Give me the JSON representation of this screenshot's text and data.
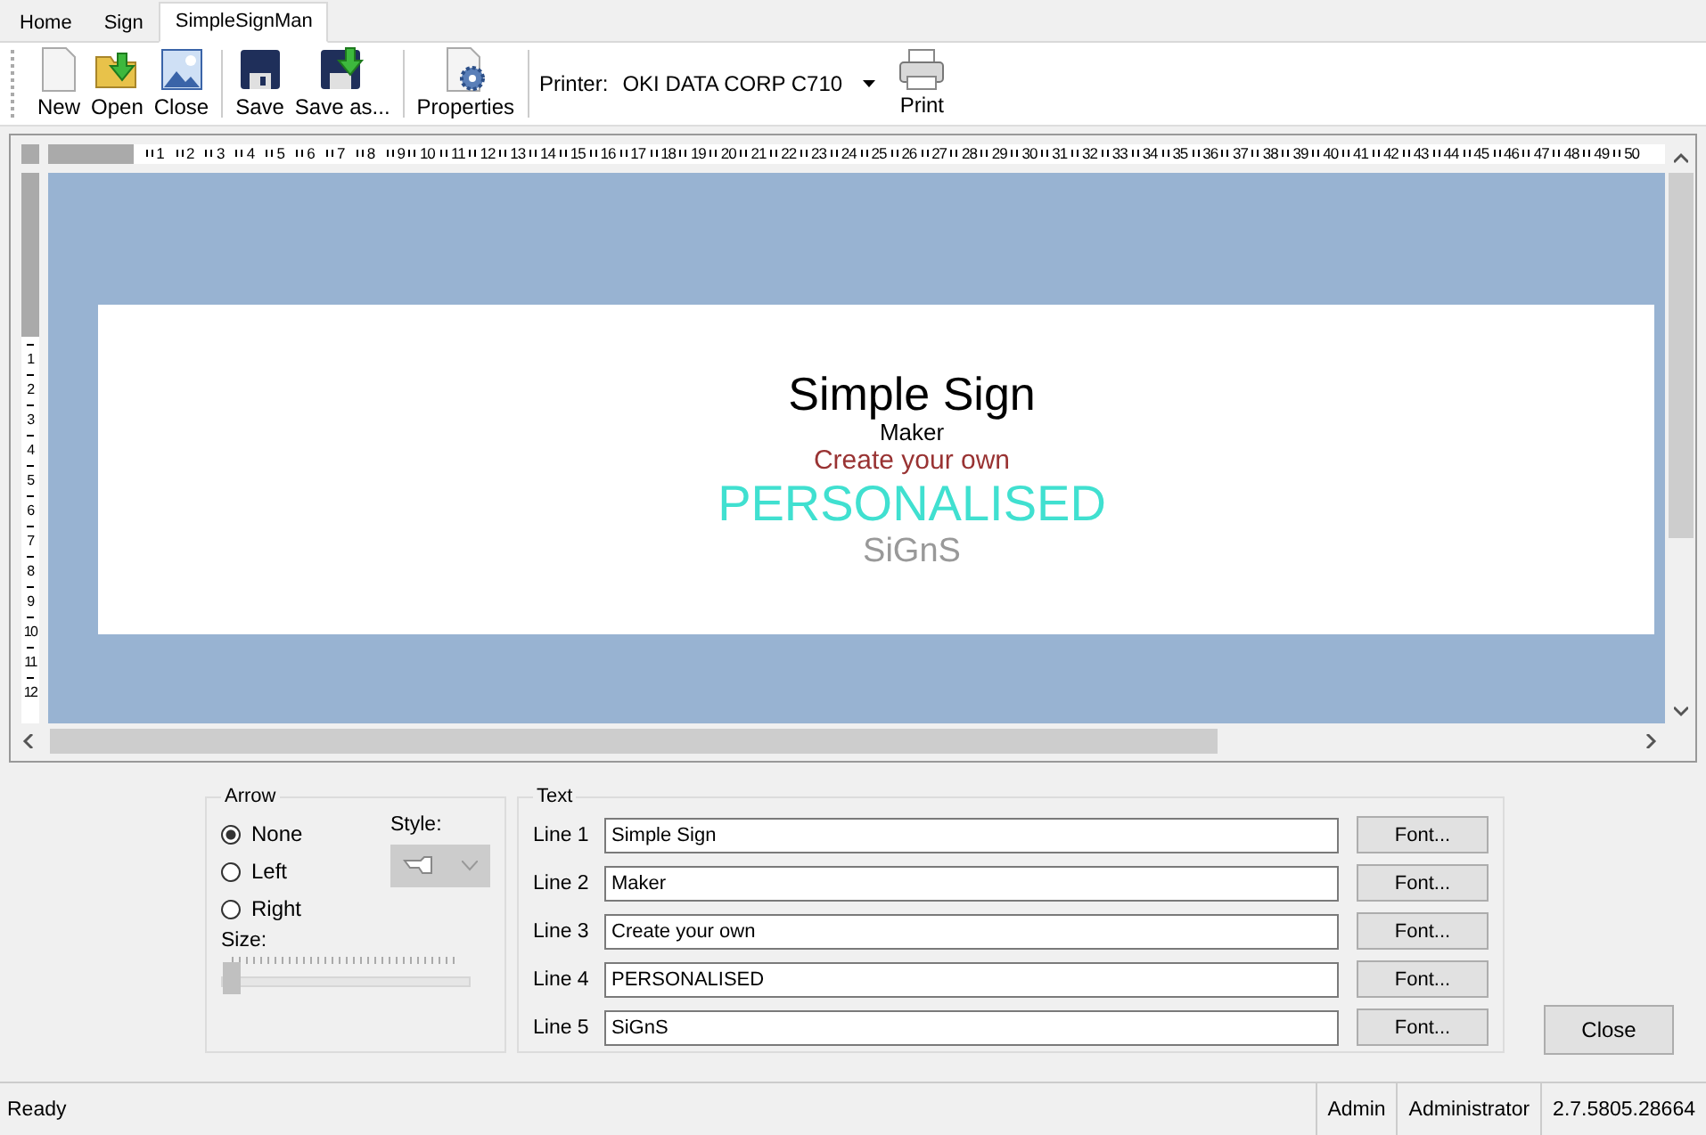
{
  "tabs": [
    {
      "label": "Home",
      "selected": false
    },
    {
      "label": "Sign",
      "selected": false
    },
    {
      "label": "SimpleSignMan",
      "selected": true
    }
  ],
  "toolbar": {
    "groups": [
      [
        {
          "kind": "new",
          "label": "New"
        },
        {
          "kind": "open",
          "label": "Open"
        },
        {
          "kind": "close",
          "label": "Close"
        }
      ],
      [
        {
          "kind": "save",
          "label": "Save"
        },
        {
          "kind": "saveas",
          "label": "Save as..."
        }
      ],
      [
        {
          "kind": "properties",
          "label": "Properties"
        }
      ]
    ],
    "printer": {
      "label": "Printer:",
      "value": "OKI DATA CORP C710"
    },
    "print_button": {
      "label": "Print"
    }
  },
  "ruler": {
    "horizontal": [
      "1",
      "2",
      "3",
      "4",
      "5",
      "6",
      "7",
      "8",
      "9",
      "10",
      "11",
      "12",
      "13",
      "14",
      "15",
      "16",
      "17",
      "18",
      "19",
      "20",
      "21",
      "22",
      "23",
      "24",
      "25",
      "26",
      "27",
      "28",
      "29",
      "30",
      "31",
      "32",
      "33",
      "34",
      "35",
      "36",
      "37",
      "38",
      "39",
      "40",
      "41",
      "42",
      "43",
      "44",
      "45",
      "46",
      "47",
      "48",
      "49",
      "50"
    ],
    "vertical": [
      "1",
      "2",
      "3",
      "4",
      "5",
      "6",
      "7",
      "8",
      "9",
      "10",
      "11",
      "12"
    ]
  },
  "sign": {
    "lines": [
      {
        "text": "Simple Sign",
        "color": "#000000"
      },
      {
        "text": "Maker",
        "color": "#000000"
      },
      {
        "text": "Create your own",
        "color": "#993333"
      },
      {
        "text": "PERSONALISED",
        "color": "#40e0d0"
      },
      {
        "text": "SiGnS",
        "color": "#999999"
      }
    ]
  },
  "arrow": {
    "title": "Arrow",
    "options": [
      {
        "label": "None",
        "selected": true
      },
      {
        "label": "Left",
        "selected": false
      },
      {
        "label": "Right",
        "selected": false
      }
    ],
    "style": {
      "label": "Style:",
      "disabled": true
    },
    "size": {
      "label": "Size:",
      "level": 0
    }
  },
  "text": {
    "title": "Text",
    "lines": [
      {
        "label": "Line 1",
        "value": "Simple Sign",
        "button": "Font..."
      },
      {
        "label": "Line 2",
        "value": "Maker",
        "button": "Font..."
      },
      {
        "label": "Line 3",
        "value": "Create your own",
        "button": "Font..."
      },
      {
        "label": "Line 4",
        "value": "PERSONALISED",
        "button": "Font..."
      },
      {
        "label": "Line 5",
        "value": "SiGnS",
        "button": "Font..."
      }
    ]
  },
  "close_button": "Close",
  "status_bar": [
    "Ready",
    "Admin",
    "Administrator",
    "2.7.5805.28664"
  ]
}
